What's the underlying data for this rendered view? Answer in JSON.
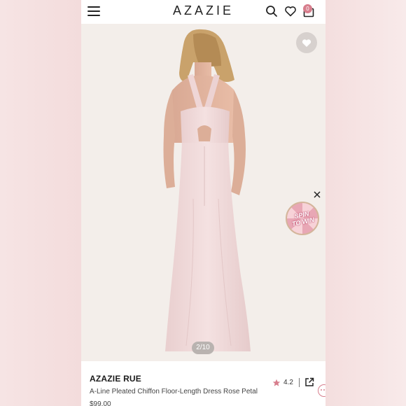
{
  "header": {
    "logo": "AZAZIE",
    "bag_count": "0"
  },
  "gallery": {
    "counter": "2/10"
  },
  "promo": {
    "line1": "SPIN",
    "line2": "TO WIN"
  },
  "product": {
    "brand": "AZAZIE RUE",
    "name": "A-Line Pleated Chiffon Floor-Length Dress Rose Petal",
    "price": "$99.00",
    "rating": "4.2"
  },
  "colors": {
    "accent": "#d77e8d",
    "dress": "#f1dcdc",
    "background": "#f3eeea"
  },
  "icons": [
    "hamburger-menu-icon",
    "search-icon",
    "heart-icon",
    "shopping-bag-icon",
    "wishlist-heart-icon",
    "close-icon",
    "star-icon",
    "share-icon",
    "chat-icon"
  ]
}
